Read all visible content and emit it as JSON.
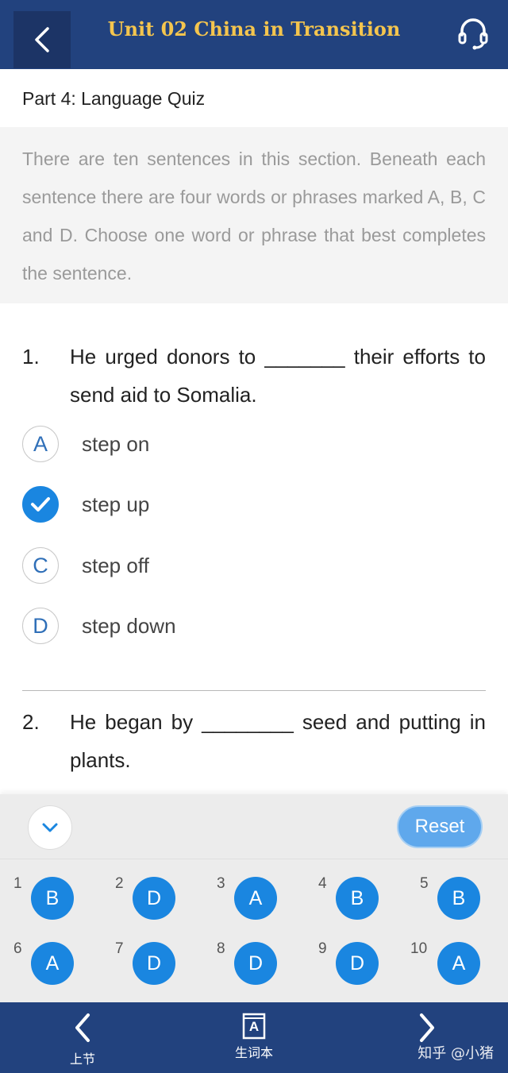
{
  "header": {
    "title": "Unit 02 China in Transition",
    "back_icon": "chevron-left-icon",
    "audio_icon": "headset-icon"
  },
  "part": {
    "title": "Part 4: Language Quiz",
    "instructions": "There are ten sentences in this section. Beneath each sentence there are four words or phrases marked A, B, C and D. Choose one word or phrase that best completes the sentence."
  },
  "questions": [
    {
      "number": "1.",
      "text": "He urged donors to _______ their efforts to send aid to Somalia.",
      "selected": "B",
      "options": [
        {
          "letter": "A",
          "text": "step on"
        },
        {
          "letter": "B",
          "text": "step up"
        },
        {
          "letter": "C",
          "text": "step off"
        },
        {
          "letter": "D",
          "text": "step down"
        }
      ]
    },
    {
      "number": "2.",
      "text": "He began by ________ seed and putting in plants."
    }
  ],
  "answer_panel": {
    "reset_label": "Reset",
    "toggle_icon": "chevron-down-icon",
    "answers": [
      {
        "num": "1",
        "ans": "B"
      },
      {
        "num": "2",
        "ans": "D"
      },
      {
        "num": "3",
        "ans": "A"
      },
      {
        "num": "4",
        "ans": "B"
      },
      {
        "num": "5",
        "ans": "B"
      },
      {
        "num": "6",
        "ans": "A"
      },
      {
        "num": "7",
        "ans": "D"
      },
      {
        "num": "8",
        "ans": "D"
      },
      {
        "num": "9",
        "ans": "D"
      },
      {
        "num": "10",
        "ans": "A"
      }
    ]
  },
  "bottom_nav": {
    "prev_label": "上节",
    "vocab_label": "生词本",
    "vocab_icon_letter": "A",
    "watermark": "知乎 @小猪"
  },
  "colors": {
    "header_bg": "#22427e",
    "title_gold": "#f4c54e",
    "accent_blue": "#1a86e0",
    "reset_blue": "#5fa8ec"
  }
}
